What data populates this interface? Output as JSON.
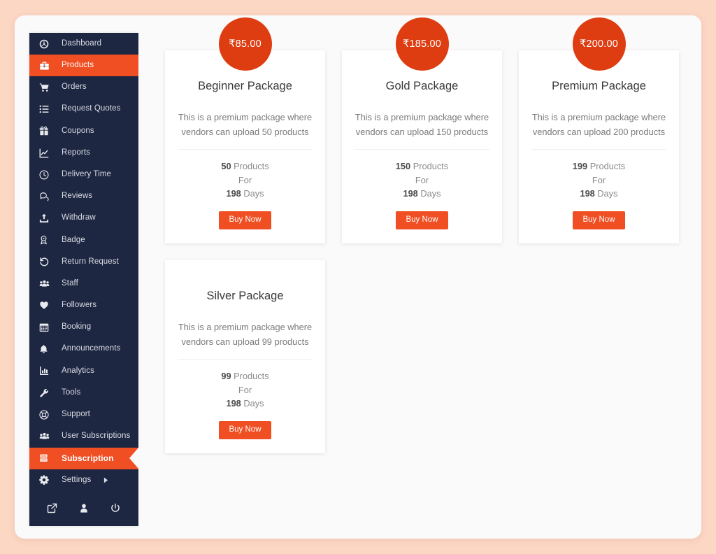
{
  "theme": {
    "page_background": "#fcd7c4",
    "panel_background": "#fafafa",
    "sidebar_background": "#1e2742",
    "accent_orange": "#f04e23",
    "badge_orange": "#de3c11",
    "card_background": "#ffffff"
  },
  "sidebar": {
    "items": [
      {
        "label": "Dashboard",
        "icon": "speedometer-icon",
        "active": false
      },
      {
        "label": "Products",
        "icon": "briefcase-icon",
        "active": true
      },
      {
        "label": "Orders",
        "icon": "shopping-cart-icon",
        "active": false
      },
      {
        "label": "Request Quotes",
        "icon": "list-icon",
        "active": false
      },
      {
        "label": "Coupons",
        "icon": "gift-icon",
        "active": false
      },
      {
        "label": "Reports",
        "icon": "chart-line-icon",
        "active": false
      },
      {
        "label": "Delivery Time",
        "icon": "clock-icon",
        "active": false
      },
      {
        "label": "Reviews",
        "icon": "chat-bubbles-icon",
        "active": false
      },
      {
        "label": "Withdraw",
        "icon": "upload-icon",
        "active": false
      },
      {
        "label": "Badge",
        "icon": "award-badge-icon",
        "active": false
      },
      {
        "label": "Return Request",
        "icon": "undo-arrow-icon",
        "active": false
      },
      {
        "label": "Staff",
        "icon": "users-group-icon",
        "active": false
      },
      {
        "label": "Followers",
        "icon": "heart-icon",
        "active": false
      },
      {
        "label": "Booking",
        "icon": "calendar-icon",
        "active": false
      },
      {
        "label": "Announcements",
        "icon": "bell-icon",
        "active": false
      },
      {
        "label": "Analytics",
        "icon": "bar-chart-icon",
        "active": false
      },
      {
        "label": "Tools",
        "icon": "wrench-icon",
        "active": false
      },
      {
        "label": "Support",
        "icon": "lifebuoy-icon",
        "active": false
      },
      {
        "label": "User Subscriptions",
        "icon": "users-group-icon",
        "active": false
      },
      {
        "label": "Subscription",
        "icon": "server-stack-icon",
        "active": true
      },
      {
        "label": "Settings",
        "icon": "gear-icon",
        "active": false,
        "has_submenu": true
      }
    ],
    "footer_icons": [
      {
        "name": "external-link-icon"
      },
      {
        "name": "user-account-icon"
      },
      {
        "name": "power-off-icon"
      }
    ]
  },
  "main": {
    "packages": [
      {
        "price": "₹85.00",
        "has_price_badge": true,
        "title": "Beginner Package",
        "description": "This is a premium package where vendors can upload 50 products",
        "products_count": "50",
        "products_label": "Products",
        "for_label": "For",
        "days_count": "198",
        "days_label": "Days",
        "buy_label": "Buy Now"
      },
      {
        "price": "₹185.00",
        "has_price_badge": true,
        "title": "Gold Package",
        "description": "This is a premium package where vendors can upload 150 products",
        "products_count": "150",
        "products_label": "Products",
        "for_label": "For",
        "days_count": "198",
        "days_label": "Days",
        "buy_label": "Buy Now"
      },
      {
        "price": "₹200.00",
        "has_price_badge": true,
        "title": "Premium Package",
        "description": "This is a premium package where vendors can upload 200 products",
        "products_count": "199",
        "products_label": "Products",
        "for_label": "For",
        "days_count": "198",
        "days_label": "Days",
        "buy_label": "Buy Now"
      },
      {
        "price": "",
        "has_price_badge": false,
        "title": "Silver Package",
        "description": "This is a premium package where vendors can upload 99 products",
        "products_count": "99",
        "products_label": "Products",
        "for_label": "For",
        "days_count": "198",
        "days_label": "Days",
        "buy_label": "Buy Now"
      }
    ]
  }
}
